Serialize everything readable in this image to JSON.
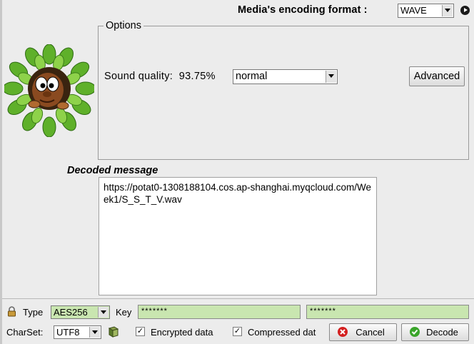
{
  "header": {
    "format_label": "Media's encoding format :",
    "format_value": "WAVE"
  },
  "options": {
    "legend": "Options",
    "sound_quality_label": "Sound quality:",
    "sound_quality_percent": "93.75%",
    "quality_value": "normal",
    "advanced_label": "Advanced"
  },
  "decoded": {
    "label": "Decoded message",
    "text": "https://potat0-1308188104.cos.ap-shanghai.myqcloud.com/Week1/S_S_T_V.wav"
  },
  "bottom": {
    "type_label": "Type",
    "type_value": "AES256",
    "key_label": "Key",
    "key1": "*******",
    "key2": "*******",
    "charset_label": "CharSet:",
    "charset_value": "UTF8",
    "encrypted_label": "Encrypted data",
    "encrypted_checked": "✓",
    "compressed_label": "Compressed dat",
    "compressed_checked": "✓",
    "cancel_label": "Cancel",
    "decode_label": "Decode"
  },
  "colors": {
    "key_field_bg": "#c9e6b0",
    "cancel_icon": "#d42020",
    "decode_icon": "#3aa52a"
  }
}
